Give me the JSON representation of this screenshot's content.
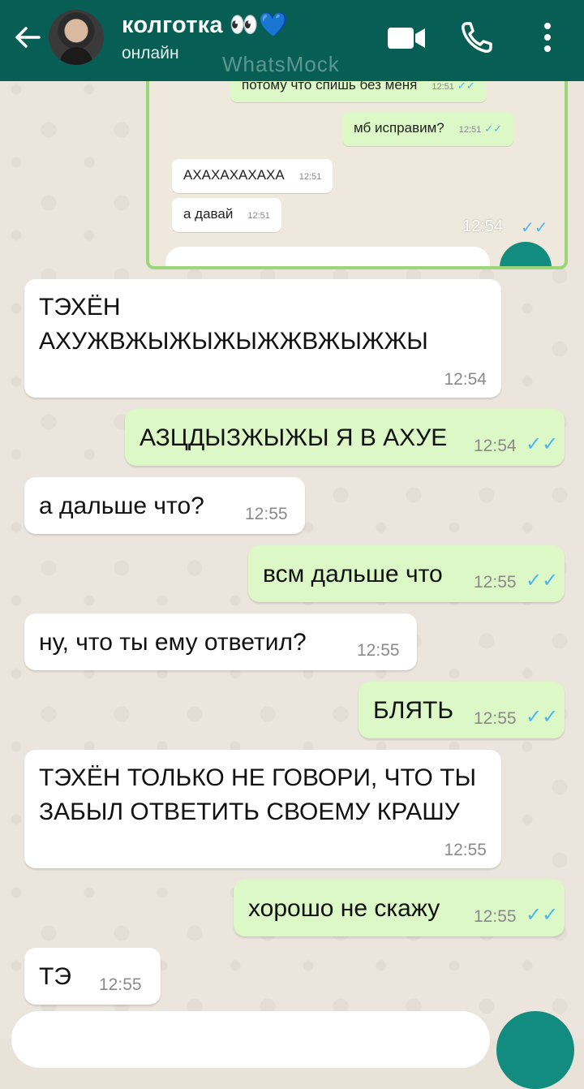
{
  "header": {
    "contact_name": "колготка 👀💙",
    "status": "онлайн",
    "watermark": "WhatsMock"
  },
  "embedded": {
    "messages": [
      {
        "text": "потому что спишь без меня",
        "time": "12:51",
        "dir": "out"
      },
      {
        "text": "мб исправим?",
        "time": "12:51",
        "dir": "out"
      },
      {
        "text": "АХАХАХАХАХА",
        "time": "12:51",
        "dir": "in"
      },
      {
        "text": "а давай",
        "time": "12:51",
        "dir": "in"
      }
    ],
    "overlay_time": "12:54"
  },
  "messages": [
    {
      "dir": "in",
      "line1": "ТЭХЁН",
      "line2": "АХУЖВЖЫЖЫЖЫЖЖВЖЫЖЖЫ",
      "time": "12:54"
    },
    {
      "dir": "out",
      "text": "АЗЦДЫЗЖЫЖЫ Я В АХУЕ",
      "time": "12:54"
    },
    {
      "dir": "in",
      "text": "а дальше что?",
      "time": "12:55"
    },
    {
      "dir": "out",
      "text": "всм дальше что",
      "time": "12:55"
    },
    {
      "dir": "in",
      "text": "ну, что ты ему ответил?",
      "time": "12:55"
    },
    {
      "dir": "out",
      "text": "БЛЯТЬ",
      "time": "12:55"
    },
    {
      "dir": "in",
      "line1": "ТЭХЁН ТОЛЬКО НЕ ГОВОРИ, ЧТО ТЫ",
      "line2": "ЗАБЫЛ ОТВЕТИТЬ СВОЕМУ КРАШУ",
      "time": "12:55"
    },
    {
      "dir": "out",
      "text": "хорошо не скажу",
      "time": "12:55"
    },
    {
      "dir": "in",
      "text": "ТЭ",
      "time": "12:55"
    }
  ],
  "colors": {
    "header": "#075e54",
    "outgoing_bubble": "#dcf8c6",
    "incoming_bubble": "#ffffff",
    "read_check": "#4fb6ec",
    "fab": "#128c7e"
  },
  "icons": {
    "back": "arrow-left-icon",
    "video": "video-camera-icon",
    "call": "phone-icon",
    "menu": "more-vertical-icon",
    "read": "double-check-icon"
  }
}
